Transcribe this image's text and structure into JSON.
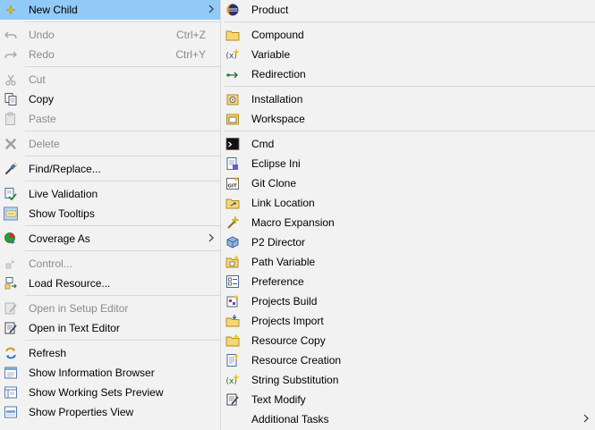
{
  "main_menu": {
    "new_child": "New Child",
    "undo": "Undo",
    "undo_shortcut": "Ctrl+Z",
    "redo": "Redo",
    "redo_shortcut": "Ctrl+Y",
    "cut": "Cut",
    "copy": "Copy",
    "paste": "Paste",
    "delete": "Delete",
    "find_replace": "Find/Replace...",
    "live_validation": "Live Validation",
    "show_tooltips": "Show Tooltips",
    "coverage_as": "Coverage As",
    "control": "Control...",
    "load_resource": "Load Resource...",
    "open_setup_editor": "Open in Setup Editor",
    "open_text_editor": "Open in Text Editor",
    "refresh": "Refresh",
    "show_info_browser": "Show Information Browser",
    "show_working_sets": "Show Working Sets Preview",
    "show_properties": "Show Properties View"
  },
  "sub_menu": {
    "product": "Product",
    "compound": "Compound",
    "variable": "Variable",
    "redirection": "Redirection",
    "installation": "Installation",
    "workspace": "Workspace",
    "cmd": "Cmd",
    "eclipse_ini": "Eclipse Ini",
    "git_clone": "Git Clone",
    "link_location": "Link Location",
    "macro_expansion": "Macro Expansion",
    "p2_director": "P2 Director",
    "path_variable": "Path Variable",
    "preference": "Preference",
    "projects_build": "Projects Build",
    "projects_import": "Projects Import",
    "resource_copy": "Resource Copy",
    "resource_creation": "Resource Creation",
    "string_substitution": "String Substitution",
    "text_modify": "Text Modify",
    "additional_tasks": "Additional Tasks"
  },
  "colors": {
    "highlight": "#91c9f7",
    "disabled_text": "#8a8a8a",
    "menu_background": "#f2f2f2"
  }
}
